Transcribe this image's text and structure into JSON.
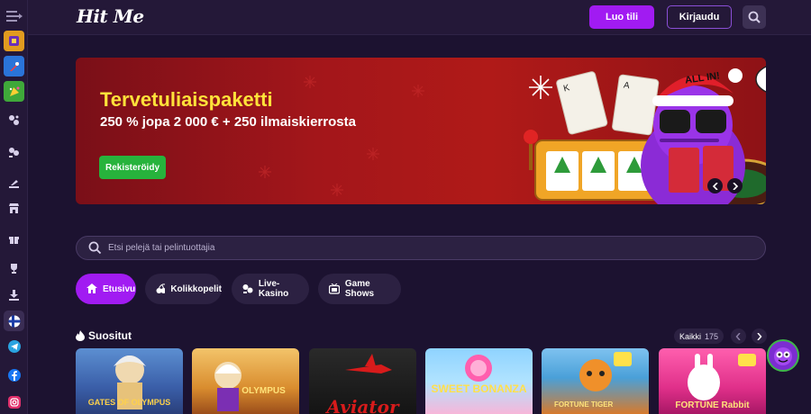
{
  "header": {
    "logo": "Hit Me",
    "signup_label": "Luo tili",
    "login_label": "Kirjaudu"
  },
  "sidebar": {
    "items": [
      "menu-toggle-icon",
      "tile-game-1",
      "tile-game-2",
      "tile-game-3",
      "slots-icon",
      "live-icon",
      "casino-icon",
      "store-icon",
      "gift-icon",
      "trophy-icon",
      "download-icon",
      "finland-flag-icon",
      "telegram-icon",
      "facebook-icon",
      "instagram-icon"
    ]
  },
  "banner": {
    "title": "Tervetuliaispaketti",
    "subtitle": "250 % jopa 2 000 € + 250 ilmaiskierrosta",
    "cta": "Rekisteröidy",
    "speech": "ALL IN!"
  },
  "search": {
    "placeholder": "Etsi pelejä tai pelintuottajia"
  },
  "tabs": [
    {
      "label": "Etusivu",
      "active": true
    },
    {
      "label": "Kolikkopelit",
      "active": false
    },
    {
      "label": "Live-Kasino",
      "active": false
    },
    {
      "label": "Game Shows",
      "active": false
    }
  ],
  "popular": {
    "title": "Suositut",
    "all_label": "Kaikki",
    "count": "175",
    "games": [
      {
        "name": "Gates of Olympus 1000",
        "label": "GATES OF OLYMPUS"
      },
      {
        "name": "Gates of Olympus Super Scatter",
        "label": "OLYMPUS"
      },
      {
        "name": "Aviator",
        "label": "Aviator"
      },
      {
        "name": "Sweet Bonanza 1000",
        "label": "SWEET BONANZA"
      },
      {
        "name": "Fortune Tiger",
        "label": "FORTUNE TIGER"
      },
      {
        "name": "Fortune Rabbit",
        "label": "FORTUNE Rabbit"
      }
    ]
  },
  "colors": {
    "accent": "#a11bf2",
    "background": "#1c1230",
    "banner_red": "#a3161a",
    "banner_title": "#ffe23a",
    "cta_green": "#27b33c"
  }
}
